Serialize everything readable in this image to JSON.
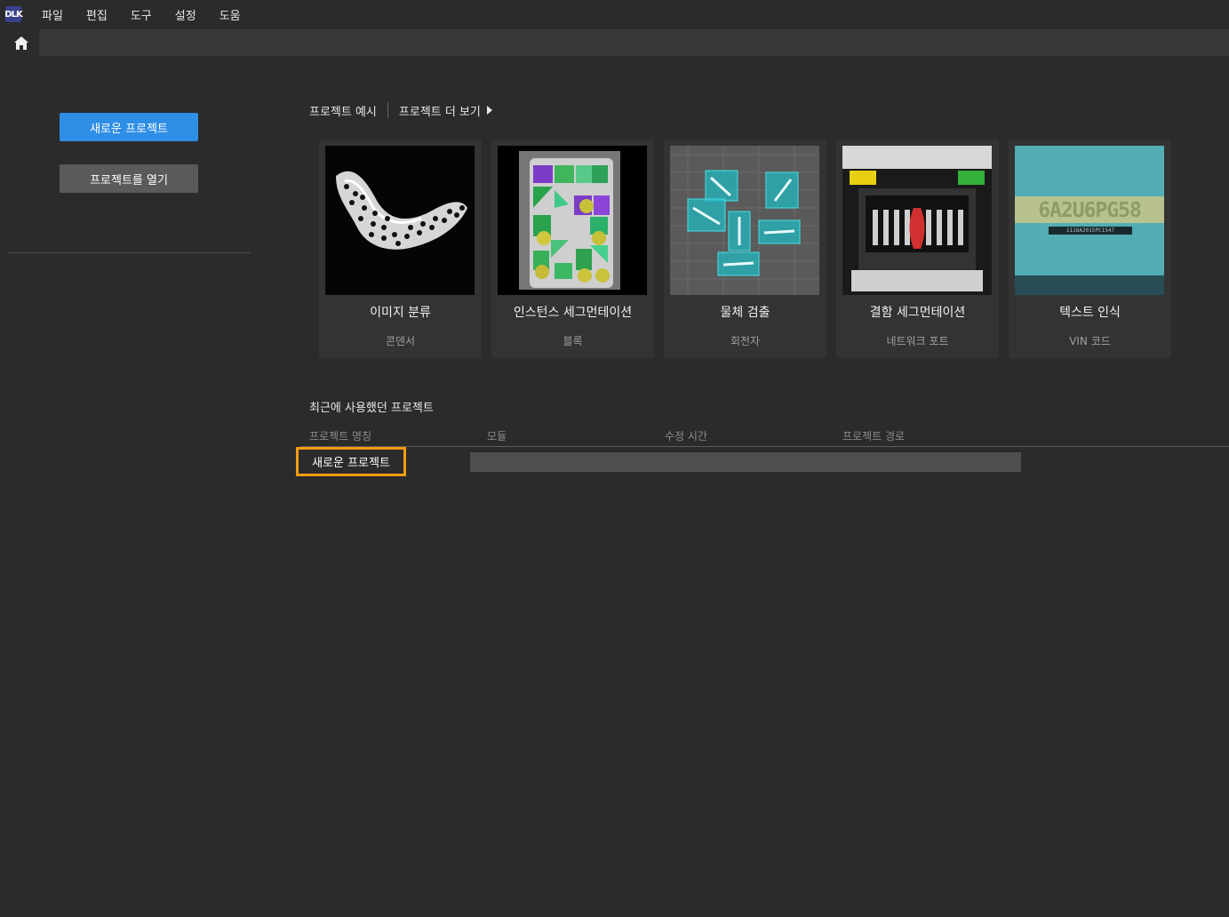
{
  "menu": {
    "logo": "DLK",
    "items": [
      "파일",
      "편집",
      "도구",
      "설정",
      "도움"
    ]
  },
  "sidebar": {
    "new_project": "새로운 프로젝트",
    "open_project": "프로젝트를 열기"
  },
  "examples": {
    "title": "프로젝트 예시",
    "more": "프로젝트 더 보기",
    "cards": [
      {
        "title": "이미지 분류",
        "subtitle": "콘덴서"
      },
      {
        "title": "인스턴스 세그먼테이션",
        "subtitle": "블록"
      },
      {
        "title": "물체 검출",
        "subtitle": "회전자"
      },
      {
        "title": "결함 세그먼테이션",
        "subtitle": "네트워크 포트"
      },
      {
        "title": "텍스트 인식",
        "subtitle": "VIN 코드"
      }
    ],
    "ocr_text": "6A2U6PG58",
    "ocr_small": "1116A2015PC1547"
  },
  "recent": {
    "title": "최근에 사용했던 프로젝트",
    "columns": [
      "프로젝트 명칭",
      "모듈",
      "수정 시간",
      "프로젝트 경로"
    ],
    "rows": [
      {
        "name": "새로운 프로젝트"
      }
    ]
  },
  "colors": {
    "accent": "#2f8ee5",
    "highlight": "#f39c12",
    "background": "#2b2b2b"
  }
}
